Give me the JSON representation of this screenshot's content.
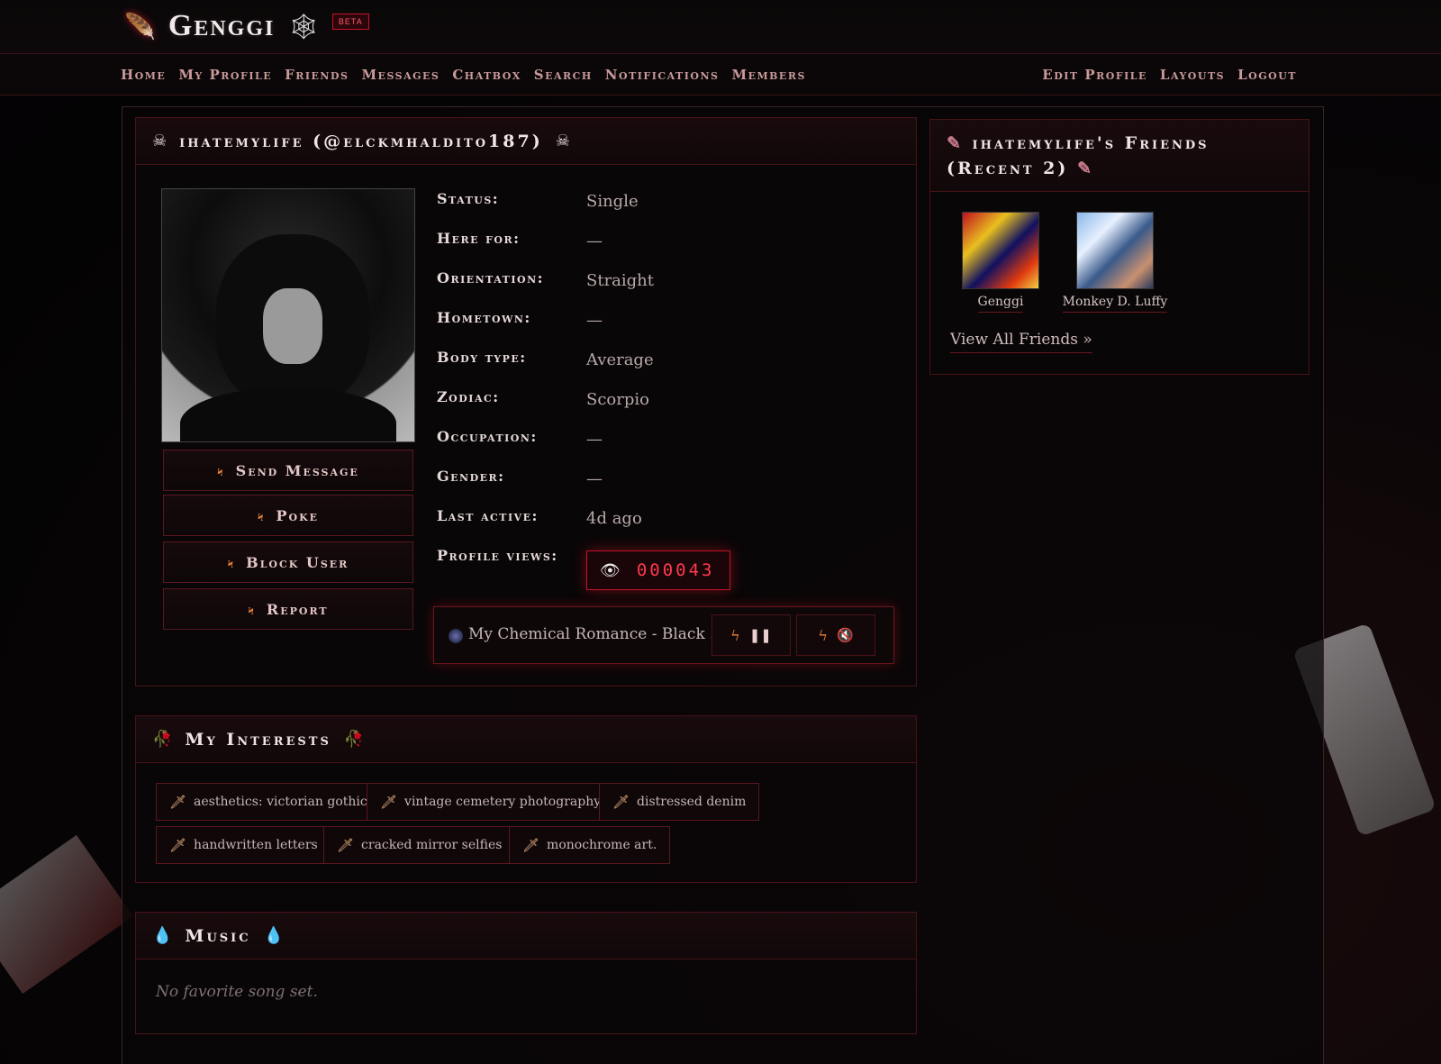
{
  "brand": {
    "name": "Genggi",
    "beta": "BETA"
  },
  "nav": {
    "left": [
      "Home",
      "My Profile",
      "Friends",
      "Messages",
      "Chatbox",
      "Search",
      "Notifications",
      "Members"
    ],
    "right": [
      "Edit Profile",
      "Layouts",
      "Logout"
    ]
  },
  "profile": {
    "title": "ihatemylife (@elckmhaldito187)",
    "actions": [
      "Send Message",
      "Poke",
      "Block User",
      "Report"
    ],
    "details": [
      {
        "label": "Status:",
        "value": "Single"
      },
      {
        "label": "Here for:",
        "value": "—"
      },
      {
        "label": "Orientation:",
        "value": "Straight"
      },
      {
        "label": "Hometown:",
        "value": "—"
      },
      {
        "label": "Body type:",
        "value": "Average"
      },
      {
        "label": "Zodiac:",
        "value": "Scorpio"
      },
      {
        "label": "Occupation:",
        "value": "—"
      },
      {
        "label": "Gender:",
        "value": "—"
      },
      {
        "label": "Last active:",
        "value": "4d ago"
      },
      {
        "label": "Profile views:",
        "value": ""
      }
    ],
    "views": "000043",
    "player": {
      "track": "My Chemical Romance - Black ..."
    }
  },
  "interests": {
    "title": "My Interests",
    "tags": [
      "aesthetics: victorian gothic",
      "vintage cemetery photography",
      "distressed denim",
      "handwritten letters",
      "cracked mirror selfies",
      "monochrome art."
    ]
  },
  "music": {
    "title": "Music",
    "empty": "No favorite song set."
  },
  "friends": {
    "title": "ihatemylife's Friends (Recent 2)",
    "list": [
      {
        "name": "Genggi"
      },
      {
        "name": "Monkey D. Luffy"
      }
    ],
    "view_all": "View All Friends »"
  },
  "colors": {
    "accent": "#c2142a",
    "bolt": "#f0873a",
    "counter": "#ff3a4e"
  },
  "icons": {
    "logo": "quill-icon",
    "web": "spiderweb-icon",
    "title": "skull-crossbones-icon",
    "action": "lightning-bolt-icon",
    "interests": "rose-icon",
    "music": "blood-drop-icon",
    "friends": "feather-icon",
    "tag": "dagger-icon",
    "views": "eye-icon"
  }
}
